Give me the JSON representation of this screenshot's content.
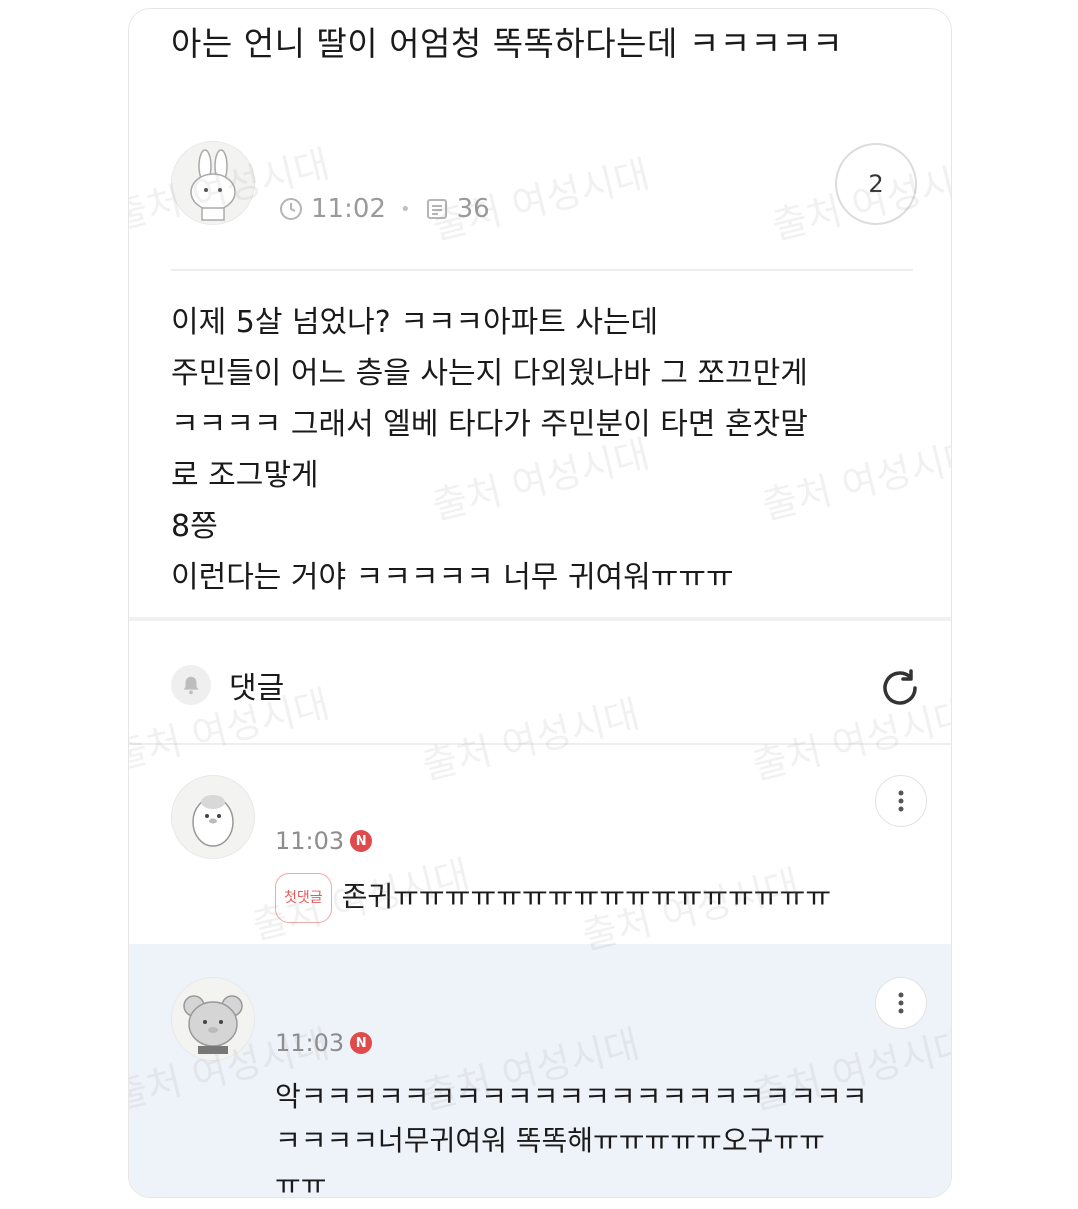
{
  "post": {
    "title": "아는 언니 딸이 어엄청 똑똑하다는데 ㅋㅋㅋㅋㅋ",
    "time": "11:02",
    "views": "36",
    "comment_count": "2",
    "body_lines": [
      "이제 5살 넘었나? ㅋㅋㅋ아파트 사는데",
      "주민들이 어느 층을 사는지 다외웠나바 그 쪼끄만게",
      "ㅋㅋㅋㅋ 그래서 엘베 타다가 주민분이 타면 혼잣말",
      "로 조그맣게",
      "8쯩",
      "이런다는 거야 ㅋㅋㅋㅋㅋ 너무 귀여워ㅠㅠㅠ"
    ]
  },
  "comments_section": {
    "label": "댓글",
    "items": [
      {
        "time": "11:03",
        "new_badge": "N",
        "first_tag": "첫댓글",
        "text": "존귀ㅠㅠㅠㅠㅠㅠㅠㅠㅠㅠㅠㅠㅠㅠㅠㅠㅠ"
      },
      {
        "time": "11:03",
        "new_badge": "N",
        "lines": [
          "악ㅋㅋㅋㅋㅋㅋㅋㅋㅋㅋㅋㅋㅋㅋㅋㅋㅋㅋㅋㅋㅋㅋ",
          "ㅋㅋㅋㅋ너무귀여워 똑똑해ㅠㅠㅠㅠㅠ오구ㅠㅠ",
          "ㅠㅠ"
        ]
      }
    ]
  },
  "watermark": "출처 여성시대",
  "colors": {
    "accent_red": "#e04a4a",
    "highlight_bg": "#eef3f9"
  }
}
